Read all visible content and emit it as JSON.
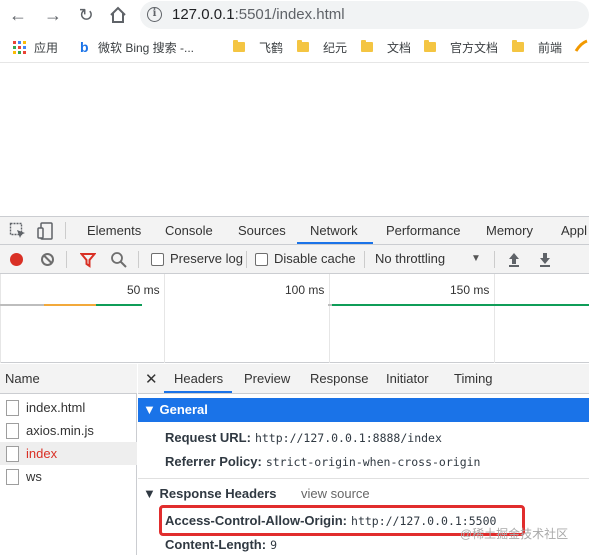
{
  "browser": {
    "url_host": "127.0.0.1",
    "url_rest": ":5501/index.html",
    "bookmarks": [
      {
        "label": "应用",
        "type": "apps"
      },
      {
        "label": "微软 Bing 搜索 -...",
        "type": "bing"
      },
      {
        "label": "飞鹤",
        "type": "folder"
      },
      {
        "label": "纪元",
        "type": "folder"
      },
      {
        "label": "文档",
        "type": "folder"
      },
      {
        "label": "官方文档",
        "type": "folder"
      },
      {
        "label": "前端",
        "type": "folder"
      }
    ]
  },
  "devtools": {
    "tabs": [
      "Elements",
      "Console",
      "Sources",
      "Network",
      "Performance",
      "Memory",
      "Appl"
    ],
    "active_tab": "Network",
    "toolbar": {
      "preserve_log": "Preserve log",
      "disable_cache": "Disable cache",
      "throttling": "No throttling"
    },
    "timeline_ticks": [
      "50 ms",
      "100 ms",
      "150 ms"
    ],
    "request_list": {
      "header": "Name",
      "items": [
        {
          "name": "index.html",
          "color": "#333333"
        },
        {
          "name": "axios.min.js",
          "color": "#333333"
        },
        {
          "name": "index",
          "color": "#d93025",
          "selected": true
        },
        {
          "name": "ws",
          "color": "#333333"
        }
      ]
    },
    "detail_tabs": [
      "Headers",
      "Preview",
      "Response",
      "Initiator",
      "Timing"
    ],
    "active_detail_tab": "Headers",
    "general": {
      "title": "General",
      "request_url_key": "Request URL:",
      "request_url_val": "http://127.0.0.1:8888/index",
      "referrer_policy_key": "Referrer Policy:",
      "referrer_policy_val": "strict-origin-when-cross-origin"
    },
    "response_headers": {
      "title": "Response Headers",
      "view_source": "view source",
      "acao_key": "Access-Control-Allow-Origin:",
      "acao_val": "http://127.0.0.1:5500",
      "content_length_key": "Content-Length:",
      "content_length_val": "9"
    }
  },
  "watermark": "@稀土掘金技术社区",
  "colors": {
    "accent": "#1a73e8",
    "record": "#d93025",
    "highlight": "#e12d2d"
  }
}
